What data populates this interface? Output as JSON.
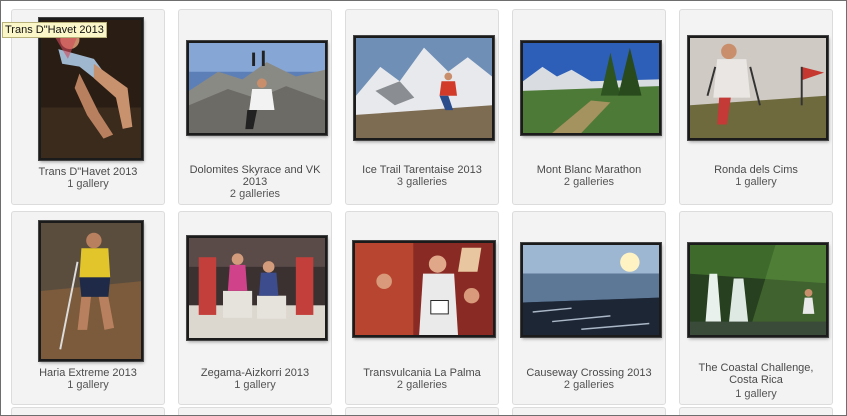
{
  "tooltip": "Trans D\"Havet 2013",
  "galleries": [
    {
      "title": "Trans D\"Havet 2013",
      "count": "1 gallery",
      "thumb": "runner-downhill"
    },
    {
      "title": "Dolomites Skyrace and VK 2013",
      "count": "2 galleries",
      "thumb": "rocky-summit"
    },
    {
      "title": "Ice Trail Tarentaise 2013",
      "count": "3 galleries",
      "thumb": "snowy-mountains"
    },
    {
      "title": "Mont Blanc Marathon",
      "count": "2 galleries",
      "thumb": "alpine-valley"
    },
    {
      "title": "Ronda dels Cims",
      "count": "1 gallery",
      "thumb": "foggy-runner"
    },
    {
      "title": "Haria Extreme 2013",
      "count": "1 gallery",
      "thumb": "volcanic-runner"
    },
    {
      "title": "Zegama-Aizkorri 2013",
      "count": "1 gallery",
      "thumb": "podium"
    },
    {
      "title": "Transvulcania La Palma",
      "count": "2 galleries",
      "thumb": "race-crowd"
    },
    {
      "title": "Causeway Crossing 2013",
      "count": "2 galleries",
      "thumb": "sunset-coast"
    },
    {
      "title": "The Coastal Challenge, Costa Rica",
      "count": "1 gallery",
      "thumb": "waterfall"
    }
  ]
}
